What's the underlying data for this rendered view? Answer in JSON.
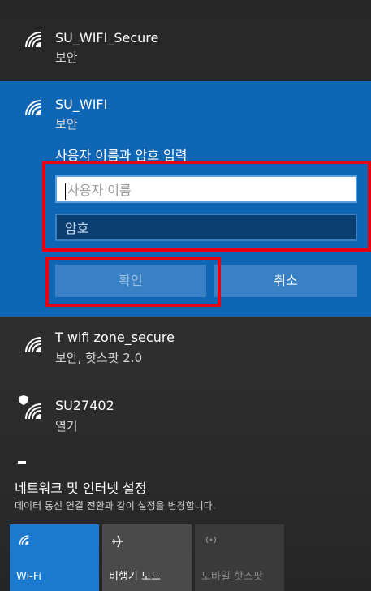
{
  "networks": [
    {
      "name": "SU_WIFI_Secure",
      "status": "보안"
    },
    {
      "name": "SU_WIFI",
      "status": "보안"
    },
    {
      "name": "T wifi zone_secure",
      "status": "보안, 핫스팟 2.0"
    },
    {
      "name": "SU27402",
      "status": "열기"
    }
  ],
  "auth": {
    "prompt": "사용자 이름과 암호 입력",
    "username_placeholder": "사용자 이름",
    "password_placeholder": "암호",
    "ok_label": "확인",
    "cancel_label": "취소"
  },
  "settings": {
    "link": "네트워크 및 인터넷 설정",
    "description": "데이터 통신 연결 전환과 같이 설정을 변경합니다."
  },
  "tiles": [
    {
      "label": "Wi-Fi",
      "icon": "wifi-icon",
      "state": "on"
    },
    {
      "label": "비행기 모드",
      "icon": "airplane-icon",
      "state": "off"
    },
    {
      "label": "모바일 핫스팟",
      "icon": "hotspot-icon",
      "state": "disabled"
    }
  ],
  "colors": {
    "accent": "#0f66b5",
    "highlight": "#e60012"
  }
}
